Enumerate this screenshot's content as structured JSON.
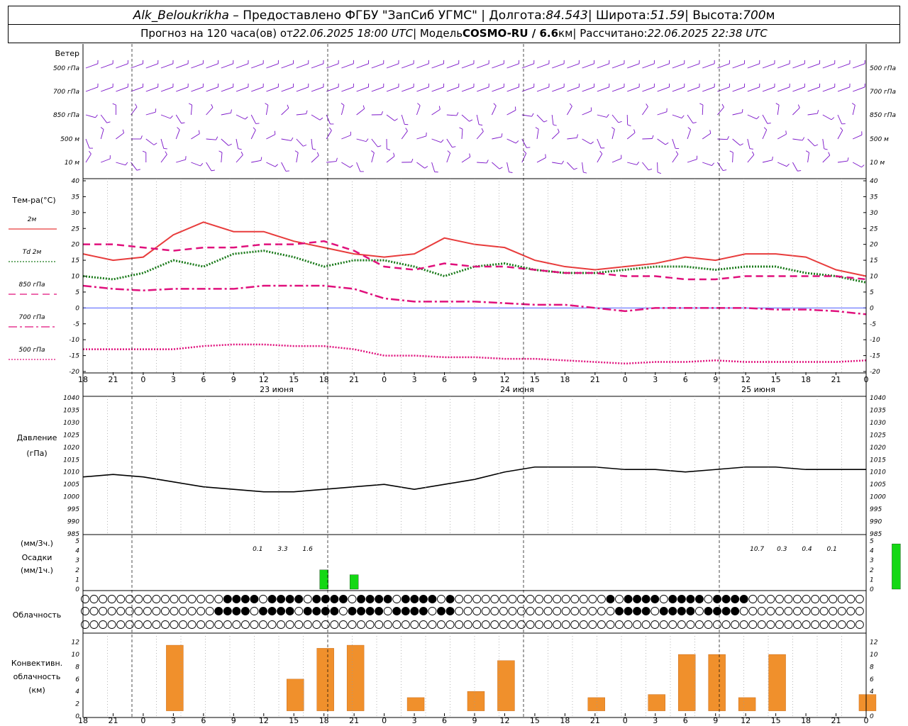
{
  "header": {
    "station": "Alk_Beloukrikha",
    "provider": "– Предоставлено ФГБУ \"ЗапСиб УГМС\" | Долгота: ",
    "lon": "84.543",
    "lat_label": " | Широта: ",
    "lat": "51.59",
    "alt_label": " | Высота: ",
    "alt": "700",
    "alt_unit": "м",
    "forecast_prefix": "Прогноз на 120 часа(ов) от ",
    "forecast_time": "22.06.2025 18:00 UTC",
    "model_prefix": "  | Модель ",
    "model": "COSMO-RU / 6.6",
    "model_unit": "км",
    "calc_prefix": " | Рассчитано: ",
    "calc_time": "22.06.2025 22:38 UTC"
  },
  "wind_panel": {
    "title": "Ветер",
    "levels": [
      "500 гПа",
      "700 гПа",
      "850 гПа",
      "500 м",
      "10  м"
    ],
    "color": "#7a12c8"
  },
  "temp_panel": {
    "title": "Тем-ра(°C)",
    "legend": [
      {
        "label": "2м",
        "color": "#e83c3c",
        "style": "solid"
      },
      {
        "label": "Td  2м",
        "color": "#1a7a1a",
        "style": "dotted"
      },
      {
        "label": "850 гПа",
        "color": "#e0107c",
        "style": "dash"
      },
      {
        "label": "700 гПа",
        "color": "#e0107c",
        "style": "dashdot"
      },
      {
        "label": "500 гПа",
        "color": "#e0107c",
        "style": "dot"
      }
    ],
    "yticks": [
      40,
      35,
      30,
      25,
      20,
      15,
      10,
      5,
      0,
      -5,
      -10,
      -15,
      -20
    ]
  },
  "pressure_panel": {
    "title": "Давление",
    "unit": "(гПа)",
    "yticks": [
      1040,
      1035,
      1030,
      1025,
      1020,
      1015,
      1010,
      1005,
      1000,
      995,
      990,
      985
    ]
  },
  "precip_panel": {
    "title1": "(мм/3ч.)",
    "title2": "Осадки",
    "title3": "(мм/1ч.)",
    "yticks": [
      5,
      4,
      3,
      2,
      1,
      0
    ],
    "totals": [
      {
        "hour": 21,
        "text": "0.1"
      },
      {
        "hour": 24,
        "text": "3.3"
      },
      {
        "hour": 27,
        "text": "1.6"
      },
      {
        "hour": 81,
        "text": "10.7"
      },
      {
        "hour": 84,
        "text": "0.3"
      },
      {
        "hour": 87,
        "text": "0.4"
      },
      {
        "hour": 90,
        "text": "0.1"
      }
    ]
  },
  "cloud_panel": {
    "title": "Облачность"
  },
  "conv_panel": {
    "title1": "Конвективн.",
    "title2": "облачность",
    "title3": "(км)",
    "yticks": [
      12,
      10,
      8,
      6,
      4,
      2,
      0
    ]
  },
  "time_axis": {
    "tick_labels": [
      "18",
      "21",
      "0",
      "3",
      "6",
      "9",
      "12",
      "15",
      "18",
      "21",
      "0",
      "3",
      "6",
      "9",
      "12",
      "15",
      "18",
      "21",
      "0",
      "3",
      "6",
      "9",
      "12",
      "15",
      "18",
      "21",
      "0"
    ],
    "day_labels": [
      {
        "hour": 18,
        "text": "23 июня"
      },
      {
        "hour": 42,
        "text": "24 июня"
      },
      {
        "hour": 66,
        "text": "25 июня"
      }
    ]
  },
  "chart_data": {
    "type": "line",
    "x_unit": "hours from 22.06.2025 18:00 UTC",
    "series": [
      {
        "name": "2м",
        "x": [
          0,
          3,
          6,
          9,
          12,
          15,
          18,
          21,
          24,
          27,
          30,
          33,
          36,
          39,
          42,
          45,
          48,
          51,
          54,
          57,
          60,
          63,
          66,
          69,
          72,
          75,
          78
        ],
        "values": [
          17,
          15,
          16,
          23,
          27,
          24,
          24,
          21,
          19,
          17,
          16,
          17,
          22,
          20,
          19,
          15,
          13,
          12,
          13,
          14,
          16,
          15,
          17,
          17,
          16,
          12,
          10
        ]
      },
      {
        "name": "Td  2м",
        "x": [
          0,
          3,
          6,
          9,
          12,
          15,
          18,
          21,
          24,
          27,
          30,
          33,
          36,
          39,
          42,
          45,
          48,
          51,
          54,
          57,
          60,
          63,
          66,
          69,
          72,
          75,
          78
        ],
        "values": [
          10,
          9,
          11,
          15,
          13,
          17,
          18,
          16,
          13,
          15,
          15,
          13,
          10,
          13,
          14,
          12,
          11,
          11,
          12,
          13,
          13,
          12,
          13,
          13,
          11,
          10,
          8
        ]
      },
      {
        "name": "850 гПа",
        "x": [
          0,
          3,
          6,
          9,
          12,
          15,
          18,
          21,
          24,
          27,
          30,
          33,
          36,
          39,
          42,
          45,
          48,
          51,
          54,
          57,
          60,
          63,
          66,
          69,
          72,
          75,
          78
        ],
        "values": [
          20,
          20,
          19,
          18,
          19,
          19,
          20,
          20,
          21,
          18,
          13,
          12,
          14,
          13,
          13,
          12,
          11,
          11,
          10,
          10,
          9,
          9,
          10,
          10,
          10,
          10,
          9
        ]
      },
      {
        "name": "700 гПа",
        "x": [
          0,
          3,
          6,
          9,
          12,
          15,
          18,
          21,
          24,
          27,
          30,
          33,
          36,
          39,
          42,
          45,
          48,
          51,
          54,
          57,
          60,
          63,
          66,
          69,
          72,
          75,
          78
        ],
        "values": [
          7,
          6,
          5.5,
          6,
          6,
          6,
          7,
          7,
          7,
          6,
          3,
          2,
          2,
          2,
          1.5,
          1,
          1,
          0,
          -1,
          0,
          0,
          0,
          0,
          -0.5,
          -0.5,
          -1,
          -2
        ]
      },
      {
        "name": "500 гПа",
        "x": [
          0,
          3,
          6,
          9,
          12,
          15,
          18,
          21,
          24,
          27,
          30,
          33,
          36,
          39,
          42,
          45,
          48,
          51,
          54,
          57,
          60,
          63,
          66,
          69,
          72,
          75,
          78
        ],
        "values": [
          -13,
          -13,
          -13,
          -13,
          -12,
          -11.5,
          -11.5,
          -12,
          -12,
          -13,
          -15,
          -15,
          -15.5,
          -15.5,
          -16,
          -16,
          -16.5,
          -17,
          -17.5,
          -17,
          -17,
          -16.5,
          -17,
          -17,
          -17,
          -17,
          -16.5
        ]
      }
    ],
    "pressure": {
      "x": [
        0,
        3,
        6,
        9,
        12,
        15,
        18,
        21,
        24,
        27,
        30,
        33,
        36,
        39,
        42,
        45,
        48,
        51,
        54,
        57,
        60,
        63,
        66,
        69,
        72,
        75,
        78
      ],
      "values": [
        1008,
        1009,
        1008,
        1006,
        1004,
        1003,
        1002,
        1002,
        1003,
        1004,
        1005,
        1003,
        1005,
        1007,
        1010,
        1012,
        1012,
        1012,
        1011,
        1011,
        1010,
        1011,
        1012,
        1012,
        1011,
        1011,
        1011
      ]
    },
    "precip_3h": [
      {
        "x": 24,
        "value": 2
      },
      {
        "x": 27,
        "value": 1.5
      },
      {
        "x": 81,
        "value": 4.7
      },
      {
        "x": 84,
        "value": 0.5
      },
      {
        "x": 87,
        "value": 0.3
      }
    ],
    "convective_cloud_km": [
      {
        "x": 9,
        "value": 11.5
      },
      {
        "x": 21,
        "value": 6
      },
      {
        "x": 24,
        "value": 11
      },
      {
        "x": 27,
        "value": 11.5
      },
      {
        "x": 33,
        "value": 3
      },
      {
        "x": 39,
        "value": 4
      },
      {
        "x": 42,
        "value": 9
      },
      {
        "x": 51,
        "value": 3
      },
      {
        "x": 57,
        "value": 3.5
      },
      {
        "x": 60,
        "value": 10
      },
      {
        "x": 63,
        "value": 10
      },
      {
        "x": 66,
        "value": 3
      },
      {
        "x": 69,
        "value": 10
      },
      {
        "x": 78,
        "value": 3.5
      }
    ],
    "ylim_temp": [
      -20,
      40
    ],
    "ylim_pressure": [
      985,
      1040
    ],
    "ylim_precip": [
      0,
      5
    ],
    "ylim_conv": [
      0,
      13
    ]
  }
}
